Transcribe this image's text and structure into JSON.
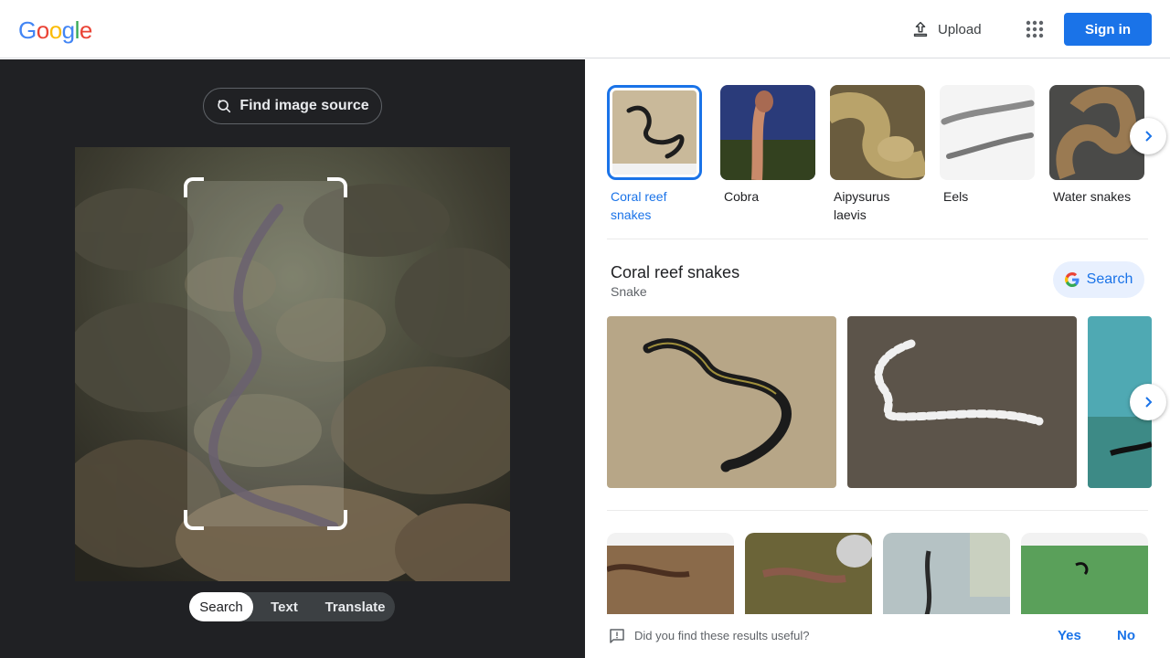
{
  "header": {
    "logo_letters": [
      "G",
      "o",
      "o",
      "g",
      "l",
      "e"
    ],
    "logo_colors": [
      "#4285f4",
      "#ea4335",
      "#fbbc05",
      "#4285f4",
      "#34a853",
      "#ea4335"
    ],
    "upload_label": "Upload",
    "signin_label": "Sign in"
  },
  "lens": {
    "find_source_label": "Find image source",
    "modes": [
      "Search",
      "Text",
      "Translate"
    ],
    "active_mode": "Search"
  },
  "related": {
    "items": [
      {
        "label": "Coral reef snakes",
        "selected": true,
        "icon": "snake-on-sand-thumb"
      },
      {
        "label": "Cobra",
        "selected": false,
        "icon": "cobra-thumb"
      },
      {
        "label": "Aipysurus laevis",
        "selected": false,
        "icon": "sea-snake-head-thumb"
      },
      {
        "label": "Eels",
        "selected": false,
        "icon": "eel-thumb"
      },
      {
        "label": "Water snakes",
        "selected": false,
        "icon": "water-snake-thumb"
      }
    ]
  },
  "entity": {
    "title": "Coral reef snakes",
    "subtitle": "Snake",
    "search_label": "Search"
  },
  "feedback": {
    "question": "Did you find these results useful?",
    "yes": "Yes",
    "no": "No"
  },
  "colors": {
    "accent": "#1a73e8",
    "dark_pane": "#202124"
  }
}
